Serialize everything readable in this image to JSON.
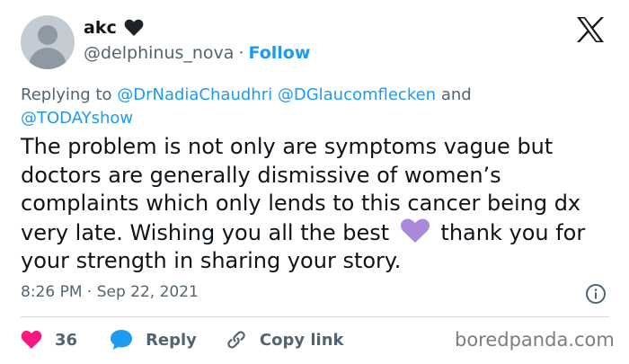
{
  "user": {
    "display_name": "akc",
    "handle": "@delphinus_nova",
    "separator": "·",
    "follow_label": "Follow"
  },
  "reply_context": {
    "prefix": "Replying to",
    "mention_1": "@DrNadiaChaudhri",
    "mention_2": "@DGlaucomflecken",
    "conjunction": "and",
    "mention_3": "@TODAYshow"
  },
  "tweet": {
    "text_before_emoji": "The problem is not only are symptoms vague but doctors are generally dismissive of women’s complaints which only lends to this cancer being dx very late. Wishing you all the best",
    "text_after_emoji": "thank you for your strength in sharing your story.",
    "emoji": "purple-heart"
  },
  "meta": {
    "timestamp": "8:26 PM · Sep 22, 2021"
  },
  "actions": {
    "like_count": "36",
    "reply_label": "Reply",
    "copy_link_label": "Copy link"
  },
  "watermark": {
    "text": "boredpanda.com"
  },
  "colors": {
    "accent": "#1d9bf0",
    "like": "#f91880",
    "secondary_text": "#536471",
    "purple_heart": "#a98ad8"
  }
}
